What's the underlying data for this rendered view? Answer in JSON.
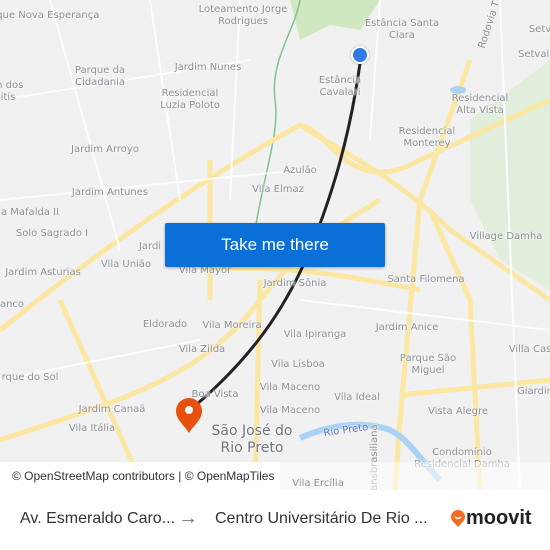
{
  "map": {
    "labels": [
      "Parque Nova Esperança",
      "Loteamento Jorge Rodrigues",
      "Estância Santa Clara",
      "Rodovia T",
      "Setv",
      "Setvall",
      "Parque da Cidadania",
      "Jardim Nunes",
      "Estância Cavalari",
      "Residencial Luzia Poloto",
      "m dos itis",
      "Residencial Alta Vista",
      "Residencial Monterey",
      "Jardim Arroyo",
      "Azulão",
      "Vila Elmaz",
      "Jardim Antunes",
      "a Mafalda II",
      "Solo Sagrado I",
      "Village Damha",
      "Jardi",
      "Vila União",
      "Vila Mayor",
      "Jardim Asturias",
      "Jardim Sônia",
      "Santa Filomena",
      "anco",
      "Eldorado",
      "Vila Moreira",
      "Vila Ipiranga",
      "Jardim Anice",
      "Vila Zilda",
      "Vila Lisboa",
      "Parque São Miguel",
      "Villa Cas",
      "rque do Sol",
      "Boa Vista",
      "Vila Maceno",
      "Vila Ideal",
      "Giardin",
      "Jardim Canaã",
      "Vila Maceno",
      "Vista Alegre",
      "Vila Itália",
      "São José do Rio Preto",
      "Rio Preto",
      "Transbrasiliana",
      "Condomínio Residencial Damha",
      "Vila Ercília"
    ],
    "colors": {
      "road": "#fbe7a1",
      "water": "#a9d3f5",
      "park": "#cfe8c2",
      "route": "#222222",
      "origin": "#2f7ae5",
      "destination": "#e8500f",
      "button": "#0a6fd6"
    },
    "origin_icon": "origin-dot-icon",
    "destination_icon": "map-pin-icon"
  },
  "cta": {
    "label": "Take me there"
  },
  "attribution": "© OpenStreetMap contributors | © OpenMapTiles",
  "footer": {
    "from": "Av. Esmeraldo Caro...",
    "arrow": "→",
    "to": "Centro Universitário De Rio ...",
    "brand": "moovit"
  }
}
